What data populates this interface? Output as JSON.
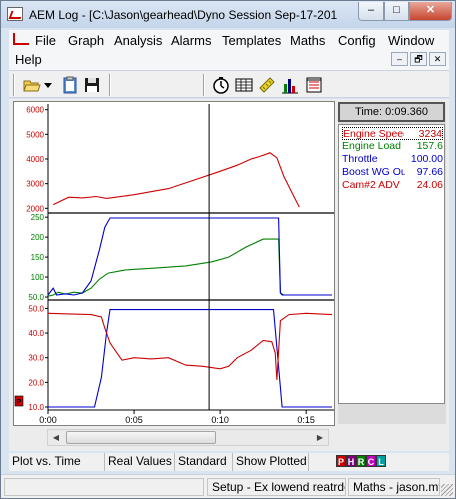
{
  "window": {
    "title": "AEM Log - [C:\\Jason\\gearhead\\Dyno Session Sep-17-201",
    "min_glyph": "‒",
    "max_glyph": "□",
    "close_glyph": "✕"
  },
  "menu": {
    "items": [
      "File",
      "Graph",
      "Analysis",
      "Alarms",
      "Templates",
      "Maths",
      "Config",
      "Window",
      "Help"
    ],
    "mdi": [
      "‒",
      "🗗",
      "✕"
    ]
  },
  "toolbar": {
    "icons": [
      "open-folder",
      "dropdown",
      "clipboard",
      "save",
      "stopwatch",
      "table",
      "ruler",
      "bar-chart",
      "data-list"
    ]
  },
  "plot": {
    "time_readout": "Time: 0:09.360",
    "cursor_time_s": 9.36,
    "x_ticks": [
      "0:00",
      "0:05",
      "0:10",
      "0:15"
    ],
    "x_tick_values": [
      0,
      5,
      10,
      15
    ],
    "x_range": [
      0,
      16.5
    ],
    "panes": [
      {
        "ticks": [
          "6000",
          "5000",
          "4000",
          "3000",
          "2000"
        ],
        "tick_values": [
          6000,
          5000,
          4000,
          3000,
          2000
        ],
        "range": [
          1850,
          6150
        ],
        "tick_color": "#cc0000"
      },
      {
        "ticks": [
          "250",
          "200",
          "150",
          "100",
          "50.0"
        ],
        "tick_values": [
          250,
          200,
          150,
          100,
          50
        ],
        "range": [
          45,
          258
        ],
        "tick_color": "#008000"
      },
      {
        "ticks": [
          "50.0",
          "40.0",
          "30.0",
          "20.0",
          "10.0"
        ],
        "tick_values": [
          50,
          40,
          30,
          20,
          10
        ],
        "range": [
          9.2,
          53
        ],
        "tick_color": "#cc0000"
      }
    ],
    "marker_label": "P"
  },
  "chart_data": {
    "type": "line",
    "x_unit": "seconds",
    "series": [
      {
        "name": "Engine Speed",
        "color": "#cc0000",
        "pane": 0,
        "x": [
          0.3,
          1.2,
          2.0,
          2.8,
          3.4,
          5.0,
          7.0,
          8.5,
          10.0,
          11.0,
          11.8,
          12.3,
          12.9,
          13.3,
          13.7,
          14.2,
          14.6
        ],
        "y": [
          2150,
          2450,
          2420,
          2480,
          2400,
          2550,
          2800,
          3150,
          3500,
          3750,
          4000,
          4100,
          4250,
          4050,
          3300,
          2600,
          2050
        ]
      },
      {
        "name": "Engine Load",
        "color": "#008000",
        "pane": 1,
        "x": [
          0.0,
          0.3,
          0.6,
          1.0,
          1.5,
          2.0,
          2.5,
          3.0,
          3.5,
          4.5,
          6.0,
          8.0,
          9.5,
          10.5,
          11.5,
          12.5,
          13.4,
          13.5,
          13.7,
          16.5
        ],
        "y": [
          52,
          55,
          62,
          57,
          62,
          60,
          72,
          95,
          110,
          118,
          122,
          128,
          138,
          150,
          175,
          195,
          195,
          60,
          55,
          55
        ]
      },
      {
        "name": "Throttle",
        "color": "#0000cc",
        "pane": 1,
        "x": [
          0.0,
          0.3,
          0.5,
          1.0,
          1.5,
          2.0,
          2.5,
          3.0,
          3.3,
          3.6,
          13.4,
          13.5,
          13.6,
          16.5
        ],
        "y": [
          55,
          72,
          55,
          58,
          55,
          60,
          90,
          170,
          225,
          248,
          248,
          60,
          55,
          55
        ]
      },
      {
        "name": "Boost WG Out",
        "color": "#0000cc",
        "pane": 2,
        "x": [
          0.0,
          2.7,
          3.1,
          3.4,
          3.6,
          13.1,
          13.35,
          13.6,
          16.5
        ],
        "y": [
          10.0,
          10.0,
          22.0,
          40.0,
          49.5,
          49.5,
          30.0,
          10.0,
          10.0
        ]
      },
      {
        "name": "Cam#2 ADV",
        "color": "#cc0000",
        "pane": 2,
        "x": [
          0.0,
          2.5,
          3.1,
          3.3,
          3.6,
          3.9,
          4.3,
          5.0,
          6.0,
          7.0,
          8.0,
          9.0,
          10.0,
          10.5,
          11.0,
          11.8,
          12.5,
          13.0,
          13.2,
          13.3,
          13.5,
          14.0,
          15.0,
          16.5
        ],
        "y": [
          48.0,
          47.5,
          46.5,
          42.0,
          36.0,
          33.0,
          29.0,
          30.0,
          29.5,
          30.0,
          27.0,
          26.5,
          25.5,
          26.5,
          30.0,
          33.0,
          37.0,
          36.5,
          32.0,
          21.0,
          45.0,
          47.5,
          48.0,
          47.5
        ]
      }
    ]
  },
  "legend": {
    "rows": [
      {
        "name": "Engine Speed",
        "value": "3234",
        "color": "#cc0000"
      },
      {
        "name": "Engine Load",
        "value": "157.6",
        "color": "#008000"
      },
      {
        "name": "Throttle",
        "value": "100.00",
        "color": "#0000cc"
      },
      {
        "name": "Boost WG Out",
        "value": "97.66",
        "color": "#0000cc"
      },
      {
        "name": "Cam#2 ADV",
        "value": "24.06",
        "color": "#cc0000"
      }
    ]
  },
  "status": {
    "mode": "Plot vs. Time",
    "values": "Real Values",
    "view": "Standard",
    "plotted": "Show Plotted",
    "buttons": [
      "P",
      "H",
      "R",
      "C",
      "L"
    ],
    "button_colors": [
      "#cc0000",
      "#7a007a",
      "#008000",
      "#c000c0",
      "#00a0a0"
    ]
  },
  "bottom": {
    "setup": "Setup - Ex lowend reatrde",
    "maths": "Maths - jason.mth"
  }
}
